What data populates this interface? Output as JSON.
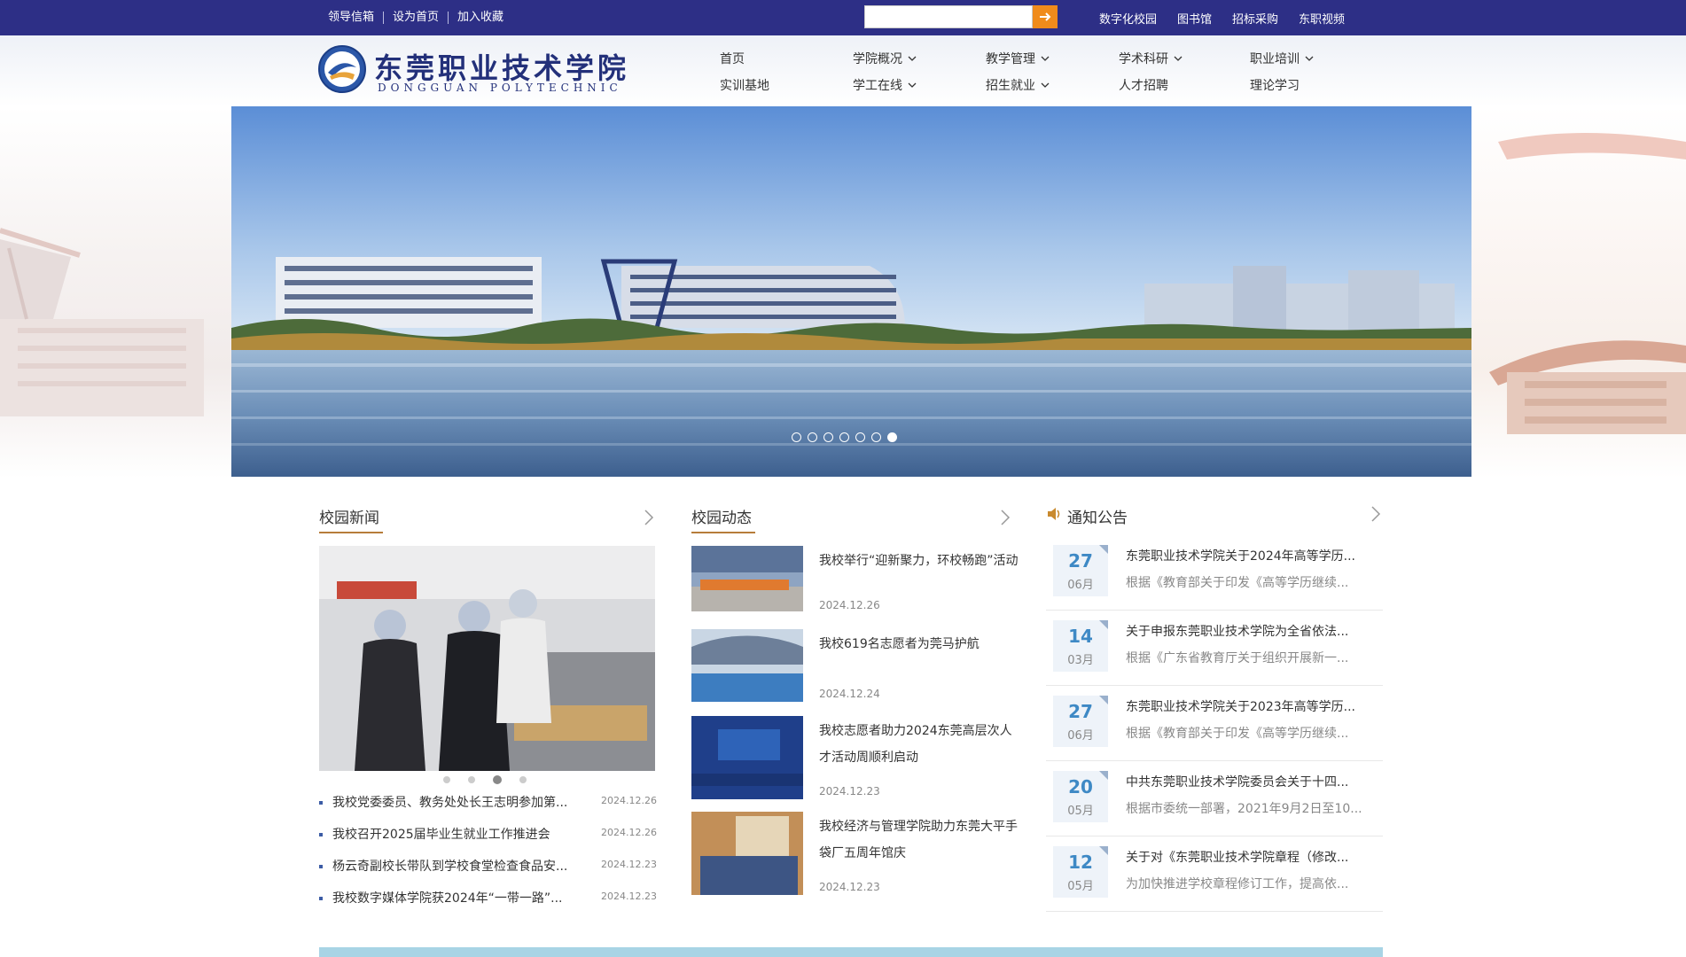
{
  "topbar": {
    "left_links": [
      "领导信箱",
      "设为首页",
      "加入收藏"
    ],
    "right_links": [
      "数字化校园",
      "图书馆",
      "招标采购",
      "东职视频"
    ],
    "search": {
      "value": "",
      "placeholder": ""
    },
    "colors": {
      "background": "#2d2f86",
      "search_button": "#f08b1b"
    }
  },
  "header": {
    "logo_cn": "东莞职业技术学院",
    "logo_en": "DONGGUAN POLYTECHNIC",
    "nav": [
      {
        "label": "首页",
        "dropdown": false
      },
      {
        "label": "学院概况",
        "dropdown": true
      },
      {
        "label": "教学管理",
        "dropdown": true
      },
      {
        "label": "学术科研",
        "dropdown": true
      },
      {
        "label": "职业培训",
        "dropdown": true
      },
      {
        "label": "实训基地",
        "dropdown": false
      },
      {
        "label": "学工在线",
        "dropdown": true
      },
      {
        "label": "招生就业",
        "dropdown": true
      },
      {
        "label": "人才招聘",
        "dropdown": false
      },
      {
        "label": "理论学习",
        "dropdown": false
      }
    ]
  },
  "banner": {
    "slide_count": 7,
    "active_slide": 7
  },
  "news": {
    "title": "校园新闻",
    "photo_slide_count": 4,
    "photo_active": 3,
    "items": [
      {
        "title": "我校党委委员、教务处处长王志明参加第...",
        "date": "2024.12.26"
      },
      {
        "title": "我校召开2025届毕业生就业工作推进会",
        "date": "2024.12.26"
      },
      {
        "title": "杨云奇副校长带队到学校食堂检查食品安...",
        "date": "2024.12.23"
      },
      {
        "title": "我校数字媒体学院获2024年“一带一路”...",
        "date": "2024.12.23"
      }
    ]
  },
  "dynamics": {
    "title": "校园动态",
    "items": [
      {
        "title": "我校举行“迎新聚力，环校畅跑”活动",
        "date": "2024.12.26"
      },
      {
        "title": "我校619名志愿者为莞马护航",
        "date": "2024.12.24"
      },
      {
        "title": "我校志愿者助力2024东莞高层次人才活动周顺利启动",
        "date": "2024.12.23"
      },
      {
        "title": "我校经济与管理学院助力东莞大平手袋厂五周年馆庆",
        "date": "2024.12.23"
      }
    ]
  },
  "notices": {
    "title": "通知公告",
    "items": [
      {
        "day": "27",
        "month": "06月",
        "title": "东莞职业技术学院关于2024年高等学历...",
        "desc": "根据《教育部关于印发《高等学历继续..."
      },
      {
        "day": "14",
        "month": "03月",
        "title": "关于申报东莞职业技术学院为全省依法...",
        "desc": "根据《广东省教育厅关于组织开展新一..."
      },
      {
        "day": "27",
        "month": "06月",
        "title": "东莞职业技术学院关于2023年高等学历...",
        "desc": "根据《教育部关于印发《高等学历继续..."
      },
      {
        "day": "20",
        "month": "05月",
        "title": "中共东莞职业技术学院委员会关于十四...",
        "desc": "根据市委统一部署，2021年9月2日至10..."
      },
      {
        "day": "12",
        "month": "05月",
        "title": "关于对《东莞职业技术学院章程（修改...",
        "desc": "为加快推进学校章程修订工作，提高依..."
      }
    ]
  }
}
